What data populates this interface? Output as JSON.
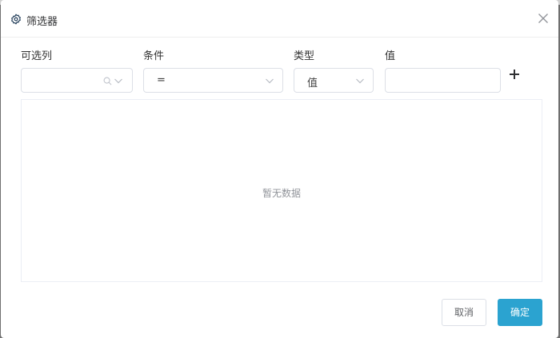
{
  "dialog": {
    "title": "筛选器",
    "icons": {
      "title": "gear-icon",
      "close": "close-icon"
    }
  },
  "labels": {
    "columns": "可选列",
    "condition": "条件",
    "type": "类型",
    "value": "值"
  },
  "fields": {
    "columns_value": "",
    "condition_value": "=",
    "type_value": "值",
    "value_input": ""
  },
  "table": {
    "empty_text": "暂无数据"
  },
  "buttons": {
    "cancel": "取消",
    "confirm": "确定"
  },
  "colors": {
    "primary": "#2ba3d0",
    "border": "#dcdfe6",
    "muted": "#909399"
  }
}
